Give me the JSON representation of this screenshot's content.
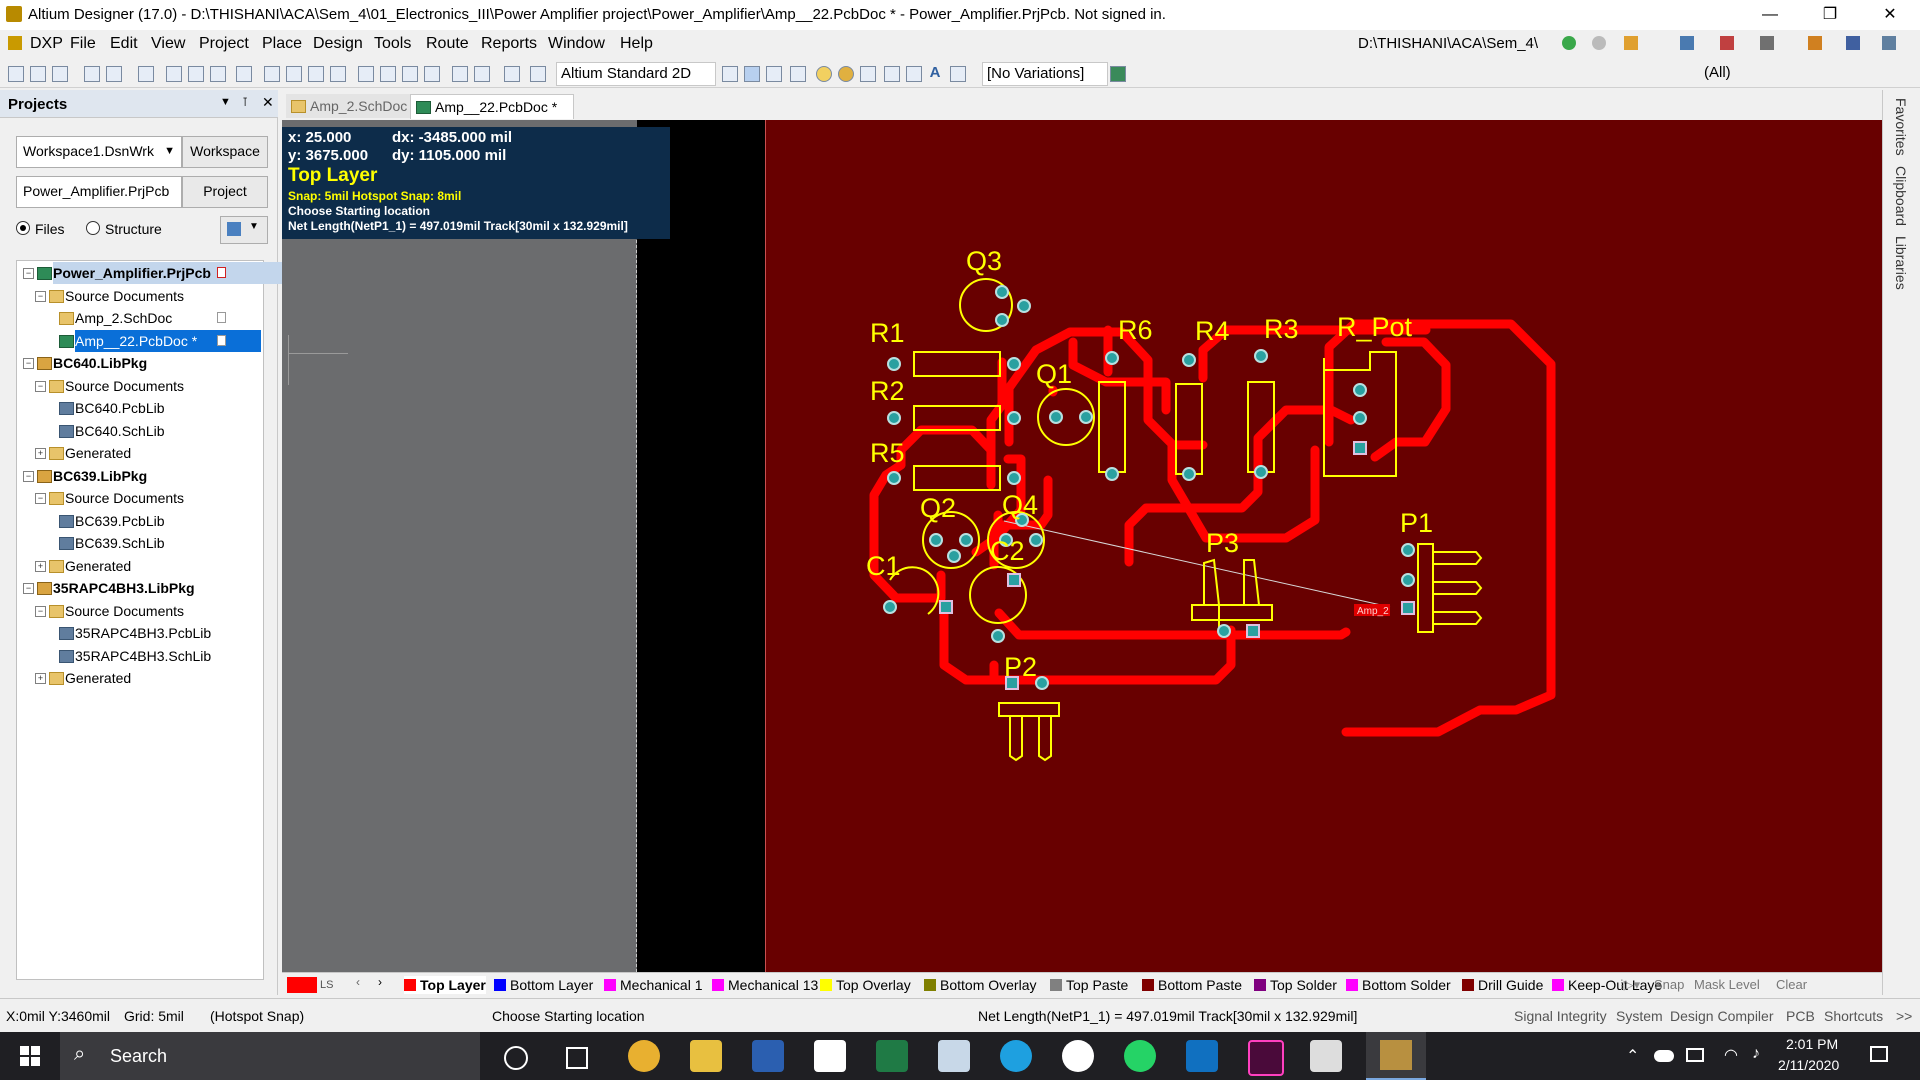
{
  "window": {
    "title": "Altium Designer (17.0) - D:\\THISHANI\\ACA\\Sem_4\\01_Electronics_III\\Power Amplifier project\\Power_Amplifier\\Amp__22.PcbDoc * - Power_Amplifier.PrjPcb. Not signed in.",
    "minimize": "—",
    "restore": "❐",
    "close": "✕"
  },
  "menu": {
    "items": [
      "DXP",
      "File",
      "Edit",
      "View",
      "Project",
      "Place",
      "Design",
      "Tools",
      "Route",
      "Reports",
      "Window",
      "Help"
    ],
    "path": "D:\\THISHANI\\ACA\\Sem_4\\"
  },
  "toolbar": {
    "view_mode": "Altium Standard 2D",
    "variations": "[No Variations]",
    "filter_all": "(All)"
  },
  "projects": {
    "title": "Projects",
    "workspace_combo": "Workspace1.DsnWrk",
    "workspace_btn": "Workspace",
    "project_field": "Power_Amplifier.PrjPcb",
    "project_btn": "Project",
    "radio_files": "Files",
    "radio_structure": "Structure",
    "tree": [
      {
        "label": "Power_Amplifier.PrjPcb",
        "level": 0,
        "icon": "project",
        "bold": true,
        "selected": "header"
      },
      {
        "label": "Source Documents",
        "level": 1,
        "icon": "folder"
      },
      {
        "label": "Amp_2.SchDoc",
        "level": 2,
        "icon": "sch"
      },
      {
        "label": "Amp__22.PcbDoc *",
        "level": 2,
        "icon": "pcb",
        "selected": "active"
      },
      {
        "label": "BC640.LibPkg",
        "level": 0,
        "icon": "pkg",
        "bold": true
      },
      {
        "label": "Source Documents",
        "level": 1,
        "icon": "folder"
      },
      {
        "label": "BC640.PcbLib",
        "level": 2,
        "icon": "lib"
      },
      {
        "label": "BC640.SchLib",
        "level": 2,
        "icon": "lib"
      },
      {
        "label": "Generated",
        "level": 1,
        "icon": "folder"
      },
      {
        "label": "BC639.LibPkg",
        "level": 0,
        "icon": "pkg",
        "bold": true
      },
      {
        "label": "Source Documents",
        "level": 1,
        "icon": "folder"
      },
      {
        "label": "BC639.PcbLib",
        "level": 2,
        "icon": "lib"
      },
      {
        "label": "BC639.SchLib",
        "level": 2,
        "icon": "lib"
      },
      {
        "label": "Generated",
        "level": 1,
        "icon": "folder"
      },
      {
        "label": "35RAPC4BH3.LibPkg",
        "level": 0,
        "icon": "pkg",
        "bold": true
      },
      {
        "label": "Source Documents",
        "level": 1,
        "icon": "folder"
      },
      {
        "label": "35RAPC4BH3.PcbLib",
        "level": 2,
        "icon": "lib"
      },
      {
        "label": "35RAPC4BH3.SchLib",
        "level": 2,
        "icon": "lib"
      },
      {
        "label": "Generated",
        "level": 1,
        "icon": "folder"
      }
    ]
  },
  "tabs": [
    {
      "label": "Amp_2.SchDoc"
    },
    {
      "label": "Amp__22.PcbDoc *"
    }
  ],
  "hud": {
    "x": "x:   25.000",
    "dx": "dx: -3485.000 mil",
    "y": "y:  3675.000",
    "dy": "dy:  1105.000 mil",
    "layer": "Top Layer",
    "snap": "Snap: 5mil Hotspot Snap: 8mil",
    "action": "Choose Starting location",
    "net": "Net Length(NetP1_1) = 497.019mil Track[30mil x 132.929mil]"
  },
  "pcb": {
    "components": [
      "Q3",
      "R1",
      "R2",
      "R6",
      "R4",
      "R3",
      "R_Pot",
      "Q1",
      "R5",
      "Q2",
      "Q4",
      "C2",
      "C1",
      "P3",
      "P1",
      "P2"
    ],
    "board_label": "Amp_2"
  },
  "right_panels": [
    "Favorites",
    "Clipboard",
    "Libraries"
  ],
  "layers": {
    "ls": "LS",
    "items": [
      {
        "label": "Top Layer",
        "color": "#ff0000",
        "active": true
      },
      {
        "label": "Bottom Layer",
        "color": "#0000ff"
      },
      {
        "label": "Mechanical 1",
        "color": "#ff00ff"
      },
      {
        "label": "Mechanical 13",
        "color": "#ff00ff"
      },
      {
        "label": "Top Overlay",
        "color": "#ffff00"
      },
      {
        "label": "Bottom Overlay",
        "color": "#808000"
      },
      {
        "label": "Top Paste",
        "color": "#808080"
      },
      {
        "label": "Bottom Paste",
        "color": "#800000"
      },
      {
        "label": "Top Solder",
        "color": "#800080"
      },
      {
        "label": "Bottom Solder",
        "color": "#ff00ff"
      },
      {
        "label": "Drill Guide",
        "color": "#800000"
      },
      {
        "label": "Keep-Out Laye",
        "color": "#ff00ff"
      }
    ],
    "snap": "Snap",
    "mask_level": "Mask Level",
    "clear": "Clear"
  },
  "status": {
    "coords": "X:0mil Y:3460mil",
    "grid": "Grid: 5mil",
    "hotspot": "(Hotspot Snap)",
    "message": "Choose Starting location",
    "net": "Net Length(NetP1_1) = 497.019mil Track[30mil x 132.929mil]",
    "panels": [
      "Signal Integrity",
      "System",
      "Design Compiler",
      "PCB",
      "Shortcuts"
    ],
    "more": ">>"
  },
  "taskbar": {
    "search": "Search",
    "time": "2:01 PM",
    "date": "2/11/2020"
  }
}
